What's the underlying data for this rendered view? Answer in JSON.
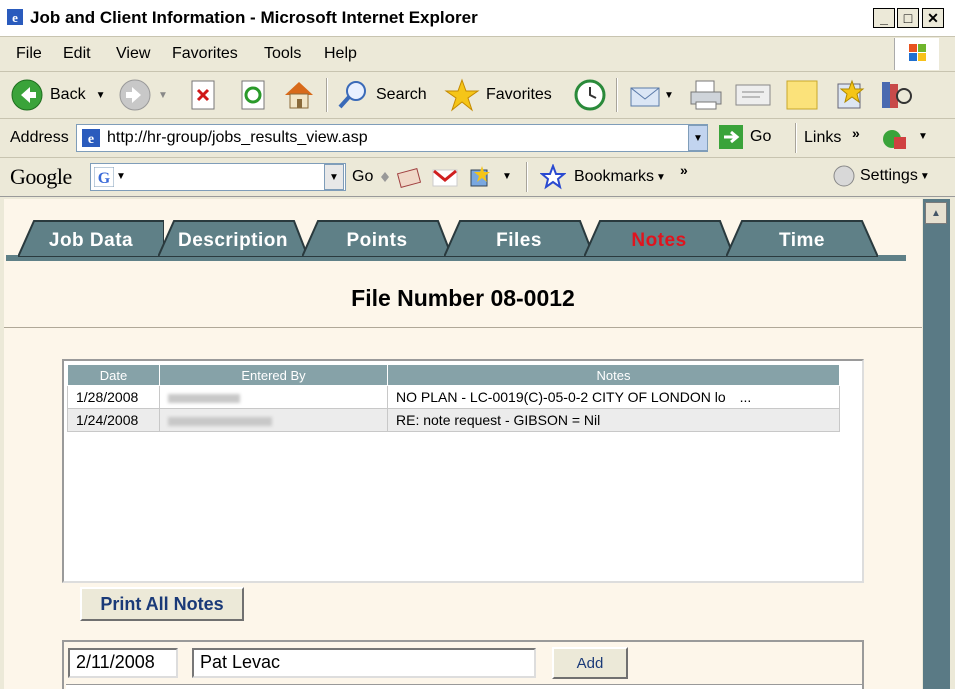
{
  "window": {
    "title": "Job and Client Information - Microsoft Internet Explorer",
    "minimize": "_",
    "maximize": "□",
    "close": "✕"
  },
  "menu": [
    "File",
    "Edit",
    "View",
    "Favorites",
    "Tools",
    "Help"
  ],
  "toolbar": {
    "back": "Back",
    "search": "Search",
    "favorites": "Favorites"
  },
  "address": {
    "label": "Address",
    "url": "http://hr-group/jobs_results_view.asp",
    "go": "Go",
    "links": "Links"
  },
  "google": {
    "logo": "Google",
    "go": "Go",
    "bookmarks": "Bookmarks",
    "settings": "Settings"
  },
  "tabs": [
    {
      "label": "Job Data",
      "active": false
    },
    {
      "label": "Description",
      "active": false
    },
    {
      "label": "Points",
      "active": false
    },
    {
      "label": "Files",
      "active": false
    },
    {
      "label": "Notes",
      "active": true
    },
    {
      "label": "Time",
      "active": false
    }
  ],
  "file_number": "File Number 08-0012",
  "notes_table": {
    "headers": [
      "Date",
      "Entered By",
      "Notes"
    ],
    "rows": [
      {
        "date": "1/28/2008",
        "notes": "NO PLAN - LC-0019(C)-05-0-2 CITY OF LONDON lo",
        "more": "..."
      },
      {
        "date": "1/24/2008",
        "notes": "RE: note request - GIBSON = Nil",
        "more": ""
      }
    ]
  },
  "print_button": "Print All Notes",
  "entry": {
    "date": "2/11/2008",
    "name": "Pat Levac",
    "add": "Add"
  },
  "colors": {
    "tab_fill": "#5f8087",
    "tab_active_text": "#e0141e",
    "content_bg": "#fdf6ea",
    "table_header": "#86a2a8"
  }
}
